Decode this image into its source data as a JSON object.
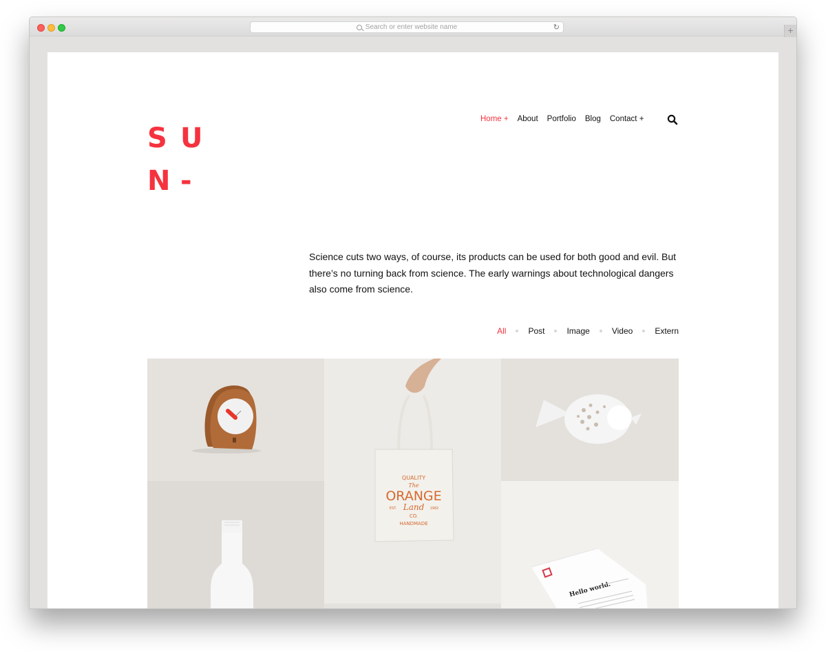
{
  "browser": {
    "url_placeholder": "Search or enter website name",
    "new_tab_label": "+",
    "reload_icon": "↻"
  },
  "site": {
    "logo_letters": [
      "S",
      "U",
      "N",
      "-"
    ],
    "nav": [
      {
        "label": "Home +",
        "active": true
      },
      {
        "label": "About",
        "active": false
      },
      {
        "label": "Portfolio",
        "active": false
      },
      {
        "label": "Blog",
        "active": false
      },
      {
        "label": "Contact +",
        "active": false
      }
    ],
    "accent_color": "#f5333f",
    "intro_text": "Science cuts two ways, of course, its products can be used for both good and evil. But there’s no turning back from science. The early warnings about technological dangers also come from science.",
    "filters": [
      {
        "label": "All",
        "active": true
      },
      {
        "label": "Post",
        "active": false
      },
      {
        "label": "Image",
        "active": false
      },
      {
        "label": "Video",
        "active": false
      },
      {
        "label": "Extern",
        "active": false
      }
    ],
    "portfolio": [
      {
        "subject": "wooden-clock"
      },
      {
        "subject": "tote-bag",
        "print_lines": [
          "QUALITY",
          "The",
          "ORANGE",
          "EST.",
          "Land",
          "1982",
          "CO.",
          "HANDMADE"
        ]
      },
      {
        "subject": "ceramic-fish"
      },
      {
        "subject": "white-bottle"
      },
      {
        "subject": "letterhead",
        "heading": "Hello world."
      }
    ]
  }
}
